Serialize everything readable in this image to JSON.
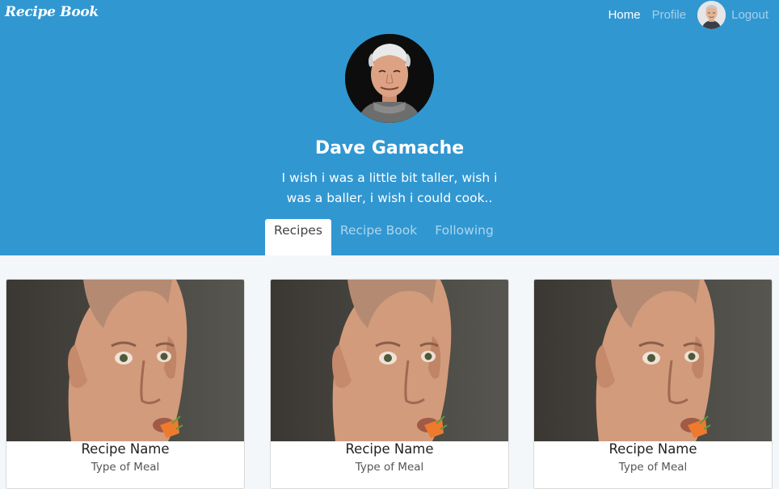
{
  "navbar": {
    "brand": "Recipe Book",
    "links": {
      "home": "Home",
      "profile": "Profile",
      "logout": "Logout"
    },
    "avatar_icon": "user-avatar-icon"
  },
  "profile": {
    "name": "Dave Gamache",
    "bio": "I wish i was a little bit taller, wish i was a baller, i wish i could cook..",
    "avatar_icon": "profile-photo-icon"
  },
  "tabs": [
    {
      "label": "Recipes",
      "active": true
    },
    {
      "label": "Recipe Book",
      "active": false
    },
    {
      "label": "Following",
      "active": false
    }
  ],
  "recipes": [
    {
      "name": "Recipe Name",
      "type": "Type of Meal",
      "image_icon": "recipe-photo-icon"
    },
    {
      "name": "Recipe Name",
      "type": "Type of Meal",
      "image_icon": "recipe-photo-icon"
    },
    {
      "name": "Recipe Name",
      "type": "Type of Meal",
      "image_icon": "recipe-photo-icon"
    }
  ],
  "colors": {
    "header_bg": "#3197d1",
    "page_bg": "#f4f7fa",
    "nav_active": "#ffffff",
    "nav_muted": "rgba(255,255,255,0.55)"
  }
}
